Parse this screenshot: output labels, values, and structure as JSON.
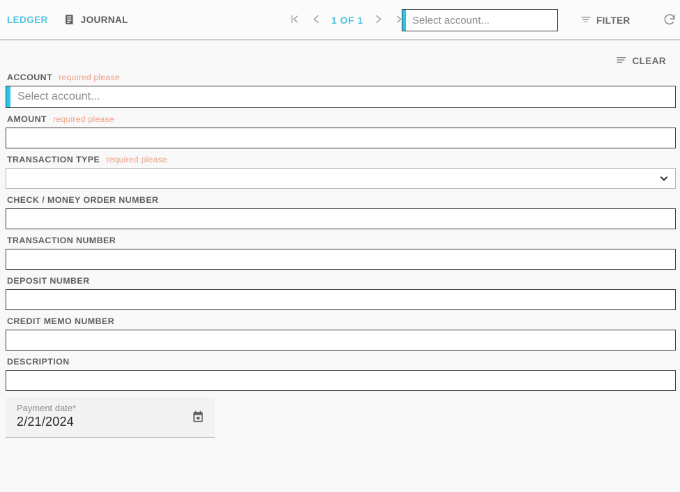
{
  "header": {
    "tabs": [
      {
        "label": "LEDGER",
        "icon": "",
        "active": true
      },
      {
        "label": "JOURNAL",
        "icon": "journal-icon",
        "active": false
      }
    ],
    "pager": {
      "first_icon": "first-page-icon",
      "prev_icon": "chevron-left-icon",
      "label": "1 OF 1",
      "next_icon": "chevron-right-icon",
      "last_icon": "last-page-icon"
    },
    "account_select": {
      "value": "",
      "placeholder": "Select account...",
      "accent_color": "#29c5e8"
    },
    "filter": {
      "label": "FILTER",
      "icon": "filter-icon"
    },
    "refresh": {
      "icon": "refresh-icon"
    }
  },
  "toolbar": {
    "clear": {
      "label": "CLEAR",
      "icon": "clear-list-icon"
    }
  },
  "form": {
    "required_text": "required please",
    "required_color": "#f2a085",
    "fields": [
      {
        "label": "ACCOUNT",
        "required": "required please",
        "type": "account-select",
        "value": "",
        "placeholder": "Select account..."
      },
      {
        "label": "AMOUNT",
        "required": "required please",
        "type": "text",
        "value": "",
        "placeholder": ""
      },
      {
        "label": "TRANSACTION TYPE",
        "required": "required please",
        "type": "select",
        "value": "",
        "placeholder": "",
        "options": [
          ""
        ]
      },
      {
        "label": "CHECK / MONEY ORDER NUMBER",
        "required": "",
        "type": "text",
        "value": "",
        "placeholder": ""
      },
      {
        "label": "TRANSACTION NUMBER",
        "required": "",
        "type": "text",
        "value": "",
        "placeholder": ""
      },
      {
        "label": "DEPOSIT NUMBER",
        "required": "",
        "type": "text",
        "value": "",
        "placeholder": ""
      },
      {
        "label": "CREDIT MEMO NUMBER",
        "required": "",
        "type": "text",
        "value": "",
        "placeholder": ""
      },
      {
        "label": "DESCRIPTION",
        "required": "",
        "type": "text",
        "value": "",
        "placeholder": ""
      }
    ],
    "payment_date": {
      "label": "Payment date*",
      "value": "2/21/2024",
      "icon": "calendar-icon"
    }
  }
}
